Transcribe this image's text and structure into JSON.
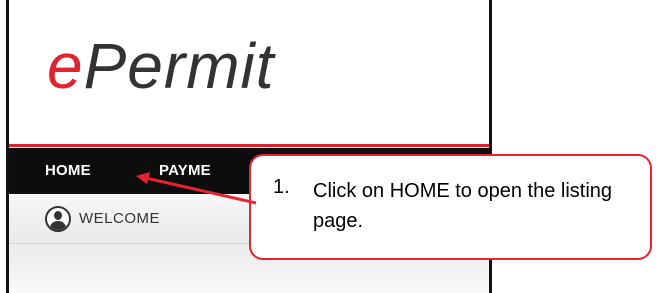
{
  "logo": {
    "prefix": "e",
    "rest": "Permit"
  },
  "nav": {
    "items": [
      {
        "label": "HOME"
      },
      {
        "label": "PAYME"
      }
    ]
  },
  "welcome": {
    "text": "WELCOME"
  },
  "callout": {
    "number": "1.",
    "text": "Click on HOME to open the listing page."
  },
  "colors": {
    "brand_red": "#e0232e",
    "nav_bg": "#0d0d0d",
    "callout_border": "#e8232d"
  }
}
